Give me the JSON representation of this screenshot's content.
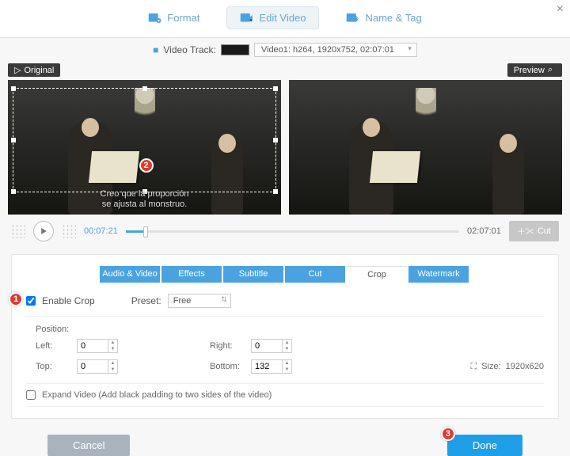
{
  "close_glyph": "×",
  "top_tabs": {
    "format": "Format",
    "edit": "Edit Video",
    "name": "Name & Tag"
  },
  "track": {
    "label": "Video Track:",
    "value": "Video1: h264, 1920x752, 02:07:01"
  },
  "preview": {
    "original": "Original",
    "preview": "Preview"
  },
  "subtitle": {
    "line1": "Creo que la proporción",
    "line2": "se ajusta al monstruo."
  },
  "player": {
    "current": "00:07:21",
    "total": "02:07:01",
    "cut": "Cut"
  },
  "subtabs": [
    "Audio & Video",
    "Effects",
    "Subtitle",
    "Cut",
    "Crop",
    "Watermark"
  ],
  "crop": {
    "enable_label": "Enable Crop",
    "enabled": true,
    "preset_label": "Preset:",
    "preset_value": "Free",
    "position_label": "Position:",
    "left_label": "Left:",
    "left_value": "0",
    "right_label": "Right:",
    "right_value": "0",
    "top_label": "Top:",
    "top_value": "0",
    "bottom_label": "Bottom:",
    "bottom_value": "132",
    "size_label": "Size:",
    "size_value": "1920x620",
    "expand_label": "Expand Video (Add black padding to two sides of the video)",
    "expand_checked": false
  },
  "footer": {
    "cancel": "Cancel",
    "done": "Done"
  },
  "badges": {
    "b1": "1",
    "b2": "2",
    "b3": "3"
  }
}
